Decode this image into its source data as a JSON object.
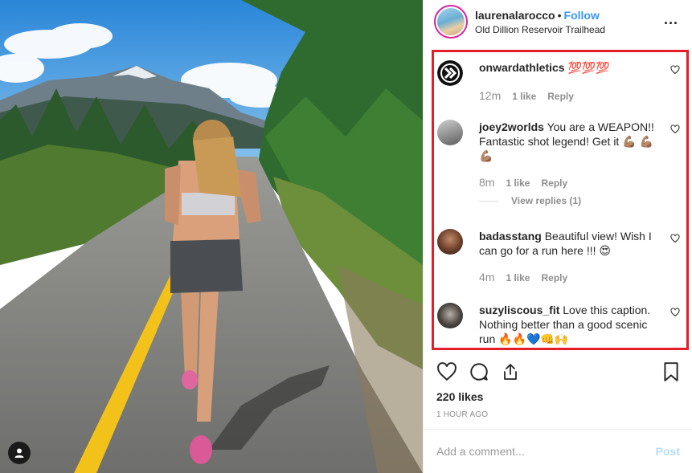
{
  "post": {
    "username": "laurenalarocco",
    "separator": "•",
    "follow_label": "Follow",
    "location": "Old Dillion Reservoir Trailhead",
    "more_label": "..."
  },
  "comments": [
    {
      "username": "onwardathletics",
      "text": "💯💯💯",
      "time": "12m",
      "likes": "1 like",
      "reply": "Reply",
      "avatar": "logo-avatar"
    },
    {
      "username": "joey2worlds",
      "text": "You are a WEAPON!! Fantastic shot legend! Get it 💪🏽 💪🏽💪🏽",
      "time": "8m",
      "likes": "1 like",
      "reply": "Reply",
      "view_replies": "View replies (1)",
      "avatar": "photo-avatar"
    },
    {
      "username": "badasstang",
      "text": "Beautiful view! Wish I can go for a run here !!! 😍",
      "time": "4m",
      "likes": "1 like",
      "reply": "Reply",
      "avatar": "photo-avatar"
    },
    {
      "username": "suzyliscous_fit",
      "text": "Love this caption. Nothing better than a good scenic run 🔥🔥💙👊🙌",
      "avatar": "photo-avatar"
    }
  ],
  "actions": {
    "like_icon": "heart-icon",
    "comment_icon": "comment-icon",
    "share_icon": "share-icon",
    "save_icon": "bookmark-icon"
  },
  "likes_count": "220 likes",
  "post_time": "1 HOUR AGO",
  "add_comment": {
    "placeholder": "Add a comment...",
    "post_label": "Post"
  },
  "colors": {
    "accent": "#3897f0",
    "highlight_border": "#e41e26",
    "muted": "#8e8e8e",
    "post_disabled": "#b2dffc"
  }
}
